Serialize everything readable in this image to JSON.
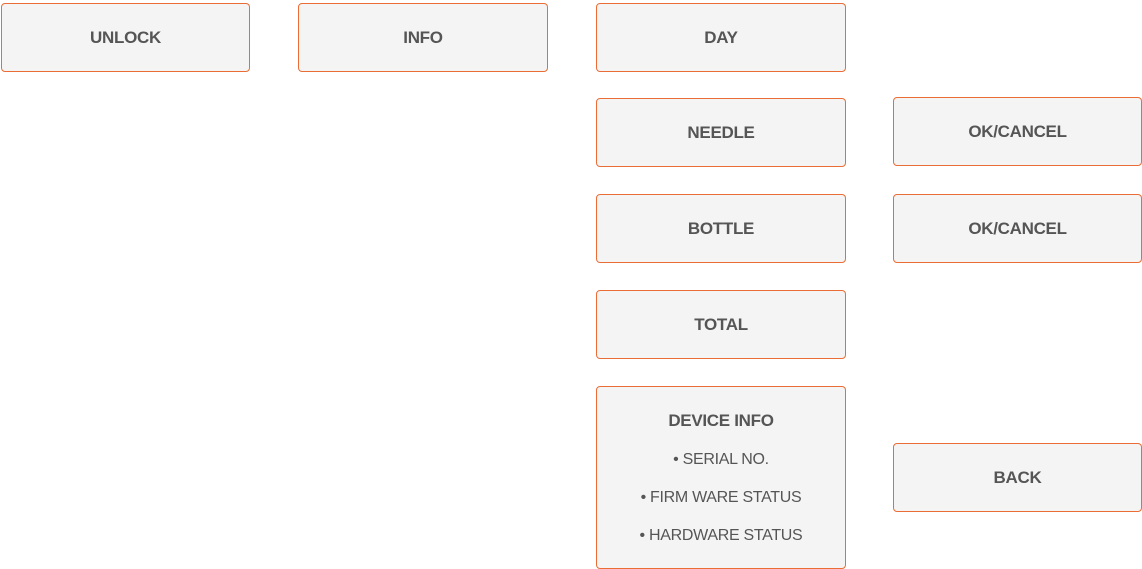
{
  "accent_color": "#ea6d35",
  "box_fill": "#f4f4f4",
  "text_color": "#555555",
  "buttons": {
    "unlock": "UNLOCK",
    "info": "INFO",
    "day": "DAY",
    "needle": "NEEDLE",
    "needle_confirm": "OK/CANCEL",
    "bottle": "BOTTLE",
    "bottle_confirm": "OK/CANCEL",
    "total": "TOTAL",
    "back": "BACK"
  },
  "device_info": {
    "title": "DEVICE INFO",
    "lines": [
      "• SERIAL NO.",
      "• FIRM WARE STATUS",
      "• HARDWARE STATUS"
    ]
  }
}
